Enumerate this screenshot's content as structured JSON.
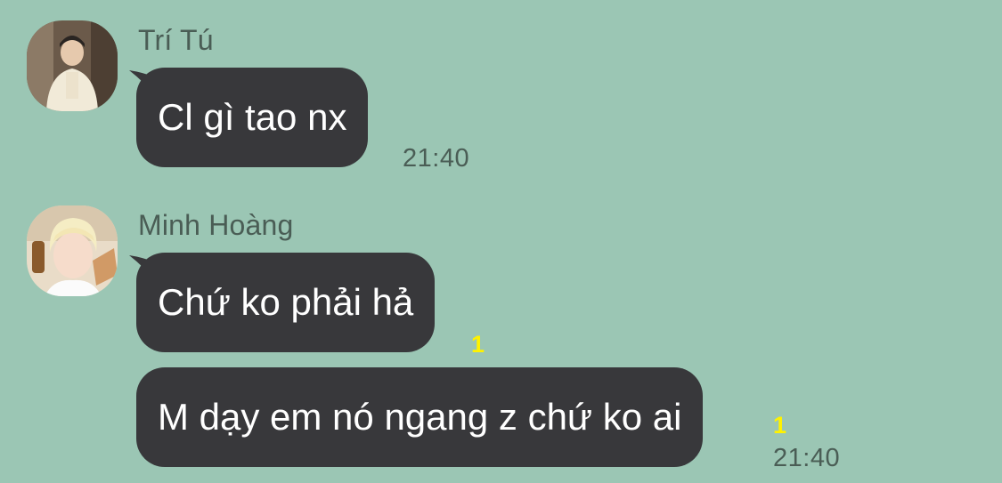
{
  "messages": [
    {
      "sender": "Trí Tú",
      "text": "Cl gì tao nx",
      "time": "21:40",
      "unread": ""
    },
    {
      "sender": "Minh Hoàng",
      "text": "Chứ ko phải hả",
      "time": "",
      "unread": "1"
    },
    {
      "sender": "Minh Hoàng",
      "text": "M dạy em nó ngang z chứ ko ai",
      "time": "21:40",
      "unread": "1"
    }
  ],
  "colors": {
    "background": "#9bc6b4",
    "bubble": "#38383b",
    "bubble_text": "#ffffff",
    "meta_text": "#4a5d55",
    "unread": "#fff200"
  }
}
